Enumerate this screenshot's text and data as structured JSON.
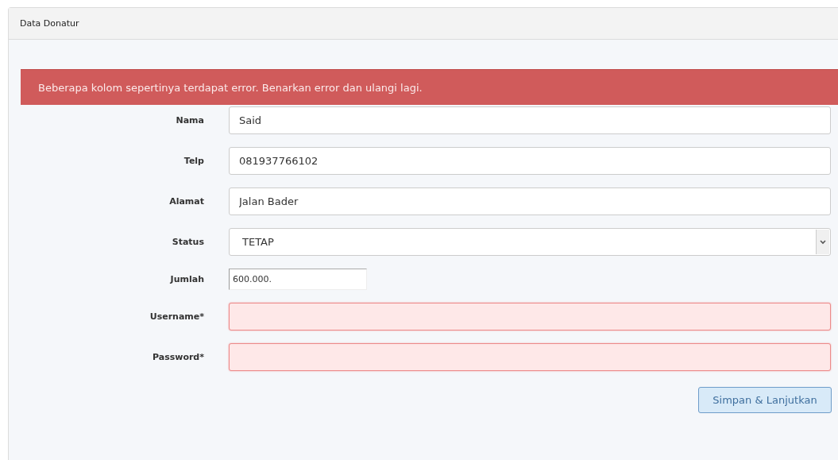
{
  "panel": {
    "title": "Data Donatur"
  },
  "alert": {
    "message": "Beberapa kolom sepertinya terdapat error. Benarkan error dan ulangi lagi."
  },
  "fields": [
    {
      "label": "Nama",
      "kind": "text",
      "value": "Said",
      "error": false
    },
    {
      "label": "Telp",
      "kind": "text",
      "value": "081937766102",
      "error": false
    },
    {
      "label": "Alamat",
      "kind": "text",
      "value": "Jalan Bader",
      "error": false
    },
    {
      "label": "Status",
      "kind": "select",
      "value": "TETAP",
      "error": false
    },
    {
      "label": "Jumlah",
      "kind": "short",
      "value": "600.000.",
      "error": false
    },
    {
      "label": "Username*",
      "kind": "text",
      "error": true
    },
    {
      "label": "Password*",
      "kind": "password",
      "error": true
    }
  ],
  "submit": {
    "label": "Simpan & Lanjutkan",
    "disabled": true
  }
}
